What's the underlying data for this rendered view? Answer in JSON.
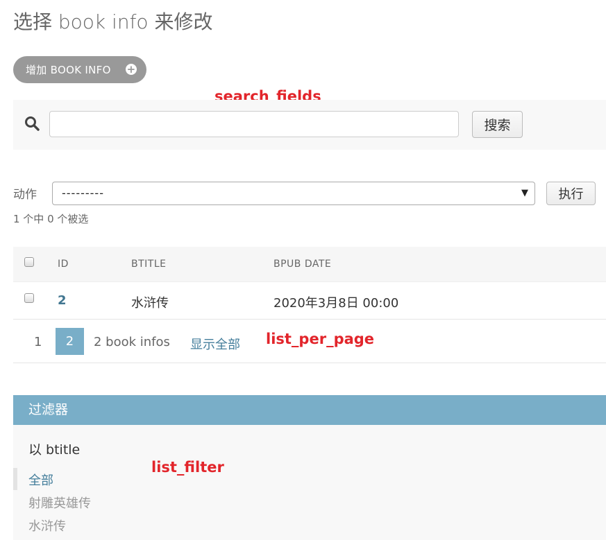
{
  "page": {
    "title": "选择 book info 来修改",
    "add_button_label": "增加 BOOK INFO",
    "add_button_icon": "plus-icon"
  },
  "annotations": {
    "search_fields": "search_fields",
    "list_per_page": "list_per_page",
    "list_filter": "list_filter",
    "color": "#e2252b"
  },
  "search": {
    "icon": "search-icon",
    "value": "",
    "placeholder": "",
    "button_label": "搜索"
  },
  "actions": {
    "label": "动作",
    "selected_option": "---------",
    "execute_label": "执行",
    "selection_count": "1 个中 0 个被选"
  },
  "table": {
    "columns": [
      "ID",
      "BTITLE",
      "BPUB DATE"
    ],
    "rows": [
      {
        "id": "2",
        "btitle": "水浒传",
        "bpub_date": "2020年3月8日 00:00"
      }
    ]
  },
  "pagination": {
    "pages": [
      "1",
      "2"
    ],
    "current_page": "2",
    "result_count": "2 book infos",
    "show_all_label": "显示全部"
  },
  "filter": {
    "header": "过滤器",
    "subhead": "以 btitle",
    "options": [
      "全部",
      "射雕英雄传",
      "水浒传"
    ],
    "selected": "全部"
  },
  "colors": {
    "accent": "#79aec8",
    "link": "#447e9b",
    "button_gray": "#999999"
  }
}
